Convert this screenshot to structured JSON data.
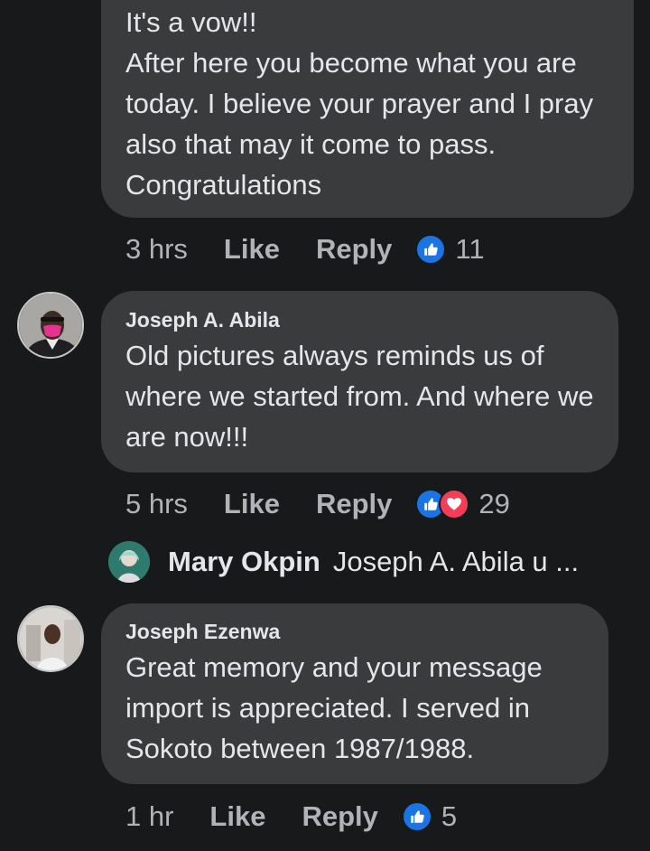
{
  "comments": [
    {
      "text": "It's a vow!!\nAfter here you become what you are today. I believe your prayer and I pray also that may it come to pass.\nCongratulations",
      "time": "3 hrs",
      "like_label": "Like",
      "reply_label": "Reply",
      "reaction_count": "11"
    },
    {
      "author": "Joseph A. Abila",
      "text": "Old pictures always reminds us of where we started from. And where we are now!!!",
      "time": "5 hrs",
      "like_label": "Like",
      "reply_label": "Reply",
      "reaction_count": "29"
    },
    {
      "author": "Joseph Ezenwa",
      "text": " Great memory and your message import is appreciated. I served in Sokoto between 1987/1988.",
      "time": "1 hr",
      "like_label": "Like",
      "reply_label": "Reply",
      "reaction_count": "5"
    }
  ],
  "reply_preview": {
    "author": "Mary Okpin",
    "text": "Joseph A. Abila u ..."
  },
  "colors": {
    "background": "#18191a",
    "bubble": "#3a3b3c",
    "like": "#1b74e4",
    "love": "#f33e58",
    "muted_text": "#b0b3b8"
  },
  "icons": [
    "like-reaction-icon",
    "love-reaction-icon"
  ]
}
